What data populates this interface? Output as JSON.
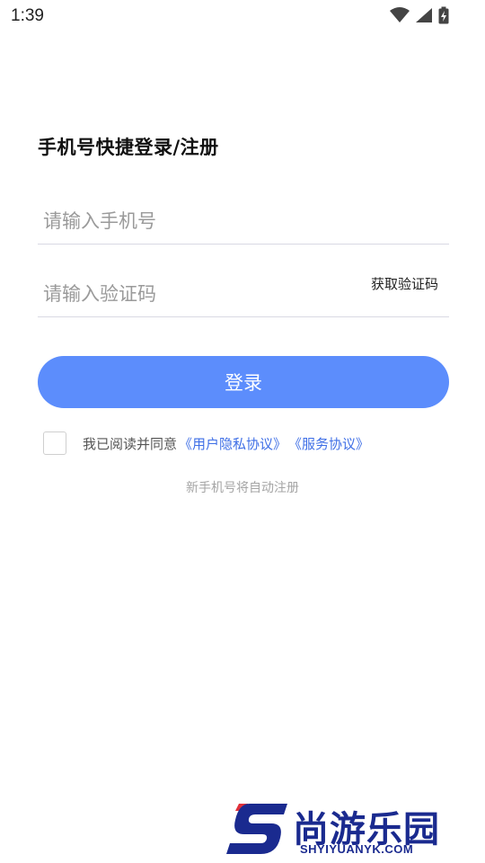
{
  "status_bar": {
    "time": "1:39",
    "icons": [
      "wifi-icon",
      "signal-icon",
      "battery-charging-icon"
    ]
  },
  "login": {
    "title": "手机号快捷登录/注册",
    "phone_placeholder": "请输入手机号",
    "code_placeholder": "请输入验证码",
    "get_code_label": "获取验证码",
    "login_button": "登录",
    "agree_text": "我已阅读并同意",
    "privacy_link": "《用户隐私协议》",
    "service_link": "《服务协议》",
    "new_user_hint": "新手机号将自动注册",
    "agree_checked": false
  },
  "watermark": {
    "brand_cn": "尚游乐园",
    "brand_en": "SHYIYUANYK.COM"
  },
  "colors": {
    "accent": "#5c8dfc",
    "link": "#3f6fe6",
    "watermark": "#1a2a8f"
  }
}
